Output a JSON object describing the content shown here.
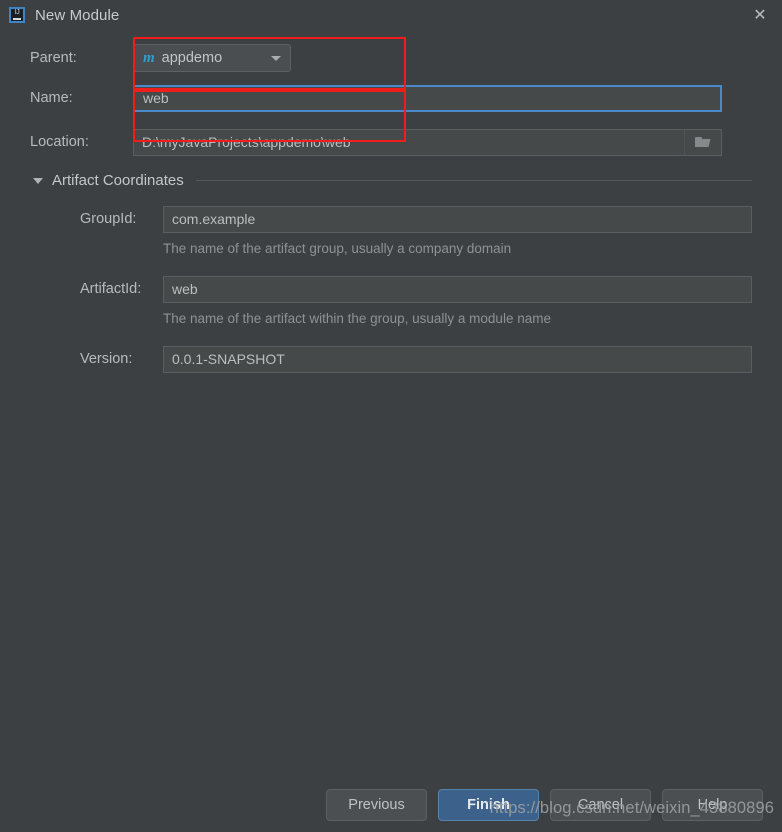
{
  "window": {
    "title": "New Module",
    "app_icon": "intellij-idea-icon",
    "close_icon": "close-icon"
  },
  "form": {
    "parent": {
      "label": "Parent:",
      "icon": "maven-module-icon",
      "icon_glyph": "m",
      "value": "appdemo",
      "dropdown_icon": "chevron-down-icon"
    },
    "name": {
      "label": "Name:",
      "value": "web"
    },
    "location": {
      "label": "Location:",
      "value": "D:\\myJavaProjects\\appdemo\\web",
      "browse_icon": "folder-icon"
    }
  },
  "artifact_section": {
    "title": "Artifact Coordinates",
    "expanded_icon": "triangle-down-icon",
    "group_id": {
      "label": "GroupId:",
      "value": "com.example",
      "hint": "The name of the artifact group, usually a company domain"
    },
    "artifact_id": {
      "label": "ArtifactId:",
      "value": "web",
      "hint": "The name of the artifact within the group, usually a module name"
    },
    "version": {
      "label": "Version:",
      "value": "0.0.1-SNAPSHOT"
    }
  },
  "buttons": {
    "previous": "Previous",
    "finish": "Finish",
    "cancel": "Cancel",
    "help": "Help"
  },
  "watermark": {
    "text": "https://blog.csdn.net/weixin_43880896"
  },
  "colors": {
    "background": "#3c4043",
    "field_background": "#45494a",
    "accent_blue": "#4a88c7",
    "primary_button": "#3c628c",
    "maven_icon": "#2f9fd0",
    "annotation_red": "#f01d1d"
  }
}
